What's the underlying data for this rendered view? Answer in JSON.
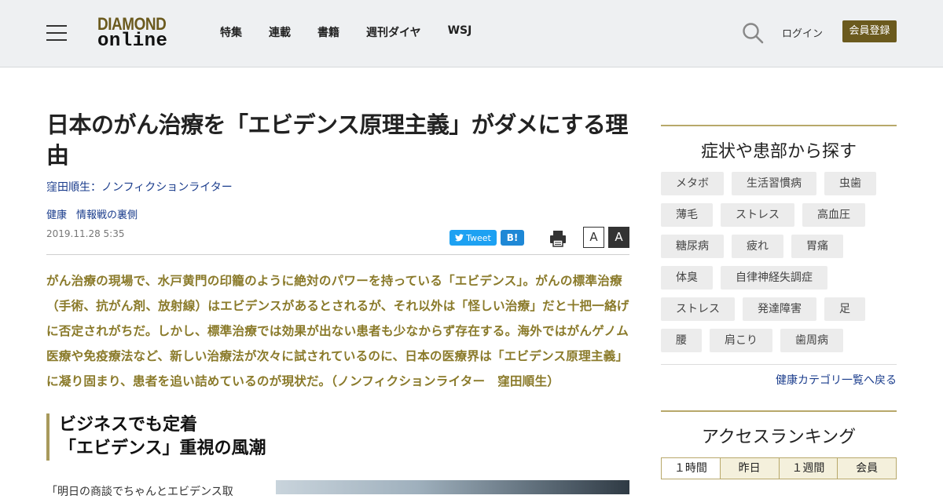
{
  "header": {
    "logo_top": "DIAMOND",
    "logo_bottom": "online",
    "nav": [
      "特集",
      "連載",
      "書籍",
      "週刊ダイヤ",
      "WSJ"
    ],
    "login": "ログイン",
    "register": "会員登録"
  },
  "article": {
    "title": "日本のがん治療を「エビデンス原理主義」がダメにする理由",
    "author": "窪田順生：ノンフィクションライター",
    "tags": [
      "健康",
      "情報戦の裏側"
    ],
    "date": "2019.11.28 5:35",
    "tweet": "Tweet",
    "hatena": "B!",
    "font_small": "A",
    "font_large": "A",
    "lead": "がん治療の現場で、水戸黄門の印籠のように絶対のパワーを持っている「エビデンス」。がんの標準治療（手術、抗がん剤、放射線）はエビデンスがあるとされるが、それ以外は「怪しい治療」だと十把一絡げに否定されがちだ。しかし、標準治療では効果が出ない患者も少なからず存在する。海外ではがんゲノム医療や免疫療法など、新しい治療法が次々に試されているのに、日本の医療界は「エビデンス原理主義」に凝り固まり、患者を追い詰めているのが現状だ。（ノンフィクションライター　窪田順生）",
    "subhead_line1": "ビジネスでも定着",
    "subhead_line2": "「エビデンス」重視の風潮",
    "body_start": "「明日の商談でちゃんとエビデンス取"
  },
  "sidebar": {
    "symptoms_title": "症状や患部から探す",
    "chips": [
      [
        "メタボ",
        "生活習慣病",
        "虫歯"
      ],
      [
        "薄毛",
        "ストレス",
        "高血圧"
      ],
      [
        "糖尿病",
        "疲れ",
        "胃痛"
      ],
      [
        "体臭",
        "自律神経失調症"
      ],
      [
        "ストレス",
        "発達障害",
        "足"
      ],
      [
        "腰",
        "肩こり",
        "歯周病"
      ]
    ],
    "back_link": "健康カテゴリ一覧へ戻る",
    "ranking_title": "アクセスランキング",
    "ranking_tabs": [
      "１時間",
      "昨日",
      "１週間",
      "会員"
    ]
  },
  "colors": {
    "brand": "#6b5a1e",
    "lead_text": "#8a7a2a",
    "link": "#1a3c8c",
    "tweet": "#1da1f2",
    "hatena": "#1e88d6"
  }
}
